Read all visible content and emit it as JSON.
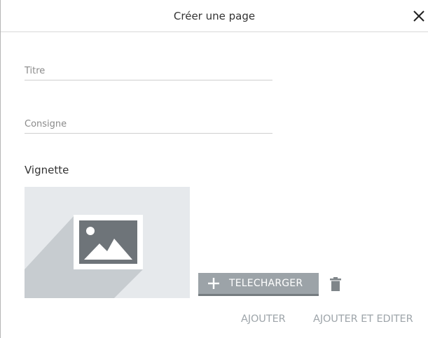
{
  "dialog": {
    "title": "Créer une page",
    "close_icon": "close-icon"
  },
  "form": {
    "title_field": {
      "value": "",
      "placeholder": "Titre"
    },
    "instruction_field": {
      "value": "",
      "placeholder": "Consigne"
    },
    "thumbnail": {
      "label": "Vignette",
      "placeholder_icon": "image-placeholder-icon"
    },
    "upload_button": {
      "label": "TELECHARGER",
      "icon": "plus-icon"
    },
    "delete_icon": "trash-icon"
  },
  "actions": {
    "add_label": "AJOUTER",
    "add_edit_label": "AJOUTER ET EDITER"
  },
  "colors": {
    "button_bg": "#9ca3a8",
    "action_text": "#9ea5aa",
    "thumbnail_bg": "#e6e9ec"
  }
}
